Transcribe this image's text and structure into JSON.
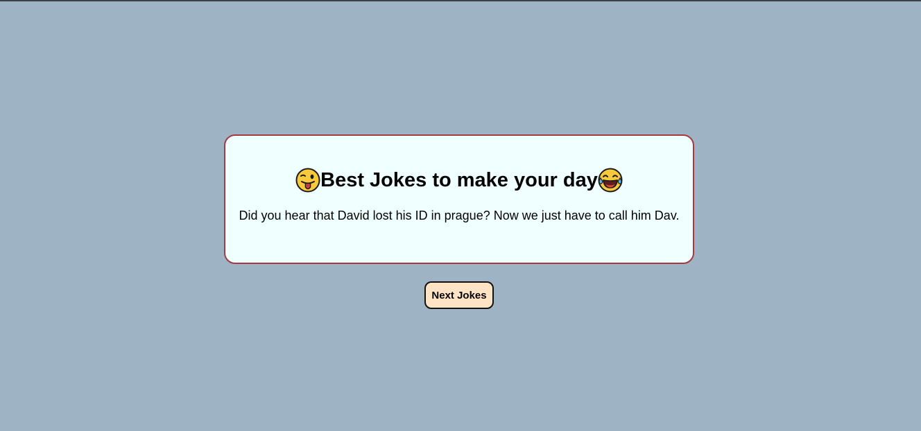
{
  "colors": {
    "background": "#9eb3c3",
    "card_background": "#f0ffff",
    "card_border": "#a43a3f",
    "button_background": "#fee4c4",
    "emoji_face": "#f9c93c"
  },
  "card": {
    "title_icon_left": "winking-face-with-tongue-icon",
    "title": "Best Jokes to make your day",
    "title_icon_right": "face-with-tears-of-joy-icon",
    "joke": "Did you hear that David lost his ID in prague? Now we just have to call him Dav."
  },
  "actions": {
    "next_label": "Next Jokes"
  }
}
